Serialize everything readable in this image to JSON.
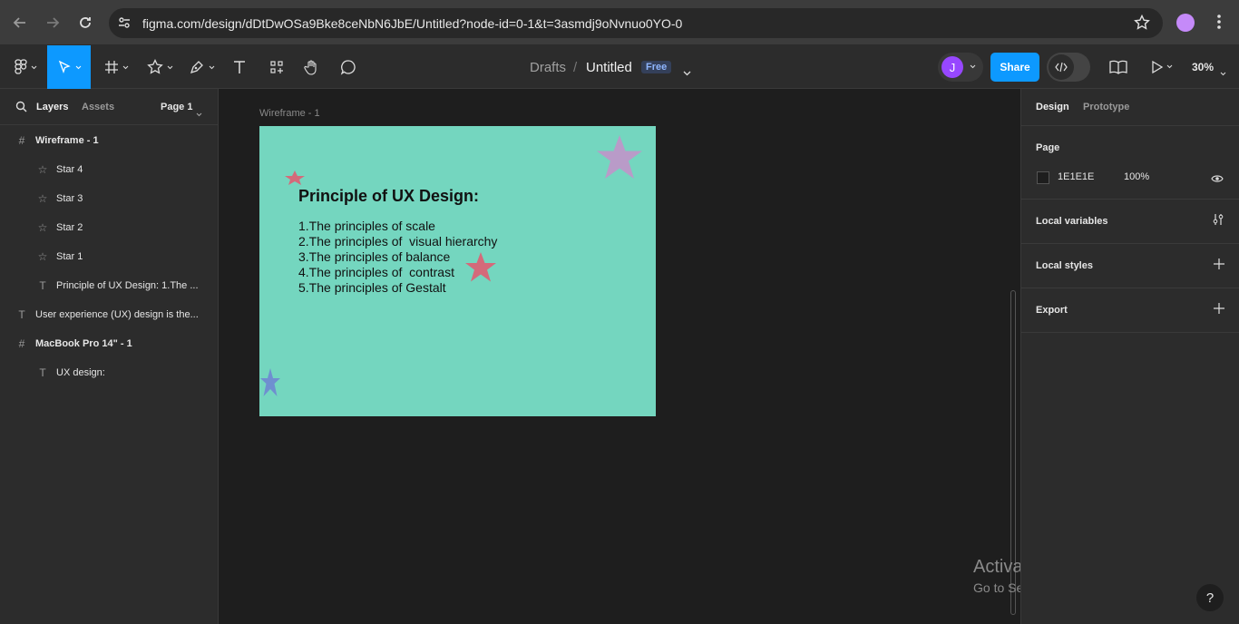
{
  "browser": {
    "url": "figma.com/design/dDtDwOSa9Bke8ceNbN6JbE/Untitled?node-id=0-1&t=3asmdj9oNvnuo0YO-0"
  },
  "toolbar": {
    "breadcrumb_drafts": "Drafts",
    "breadcrumb_sep": "/",
    "file_name": "Untitled",
    "plan_badge": "Free",
    "avatar_initial": "J",
    "share_label": "Share",
    "zoom": "30%"
  },
  "left_panel": {
    "tab_layers": "Layers",
    "tab_assets": "Assets",
    "page_selector": "Page 1",
    "layers": [
      {
        "label": "Wireframe - 1",
        "icon": "frame-icon",
        "bold": true
      },
      {
        "label": "Star 4",
        "icon": "star-icon"
      },
      {
        "label": "Star 3",
        "icon": "star-icon"
      },
      {
        "label": "Star 2",
        "icon": "star-icon"
      },
      {
        "label": "Star 1",
        "icon": "star-icon"
      },
      {
        "label": "Principle of UX Design: 1.The ...",
        "icon": "text-icon"
      },
      {
        "label": "User experience (UX) design is the...",
        "icon": "text-icon"
      },
      {
        "label": "MacBook Pro 14\" - 1",
        "icon": "frame-icon",
        "bold": true
      },
      {
        "label": "UX design:",
        "icon": "text-icon"
      }
    ]
  },
  "canvas": {
    "frame_label": "Wireframe - 1",
    "frame_color": "#74d6bf",
    "title": "Principle of UX  Design:",
    "lines": [
      "1.The principles of scale",
      "2.The principles of  visual hierarchy",
      "3.The principles of balance",
      "4.The principles of  contrast",
      "5.The principles of Gestalt"
    ],
    "watermark_title": "Activate Windows",
    "watermark_sub": "Go to Settings to activate Windows."
  },
  "right_panel": {
    "tab_design": "Design",
    "tab_prototype": "Prototype",
    "page_title": "Page",
    "page_color": "1E1E1E",
    "page_opacity": "100%",
    "local_variables": "Local variables",
    "local_styles": "Local styles",
    "export": "Export"
  },
  "colors": {
    "accent": "#0d99ff",
    "star_purple": "#b99bc8",
    "star_red": "#d46a7a",
    "star_blue": "#6f8fd0"
  }
}
